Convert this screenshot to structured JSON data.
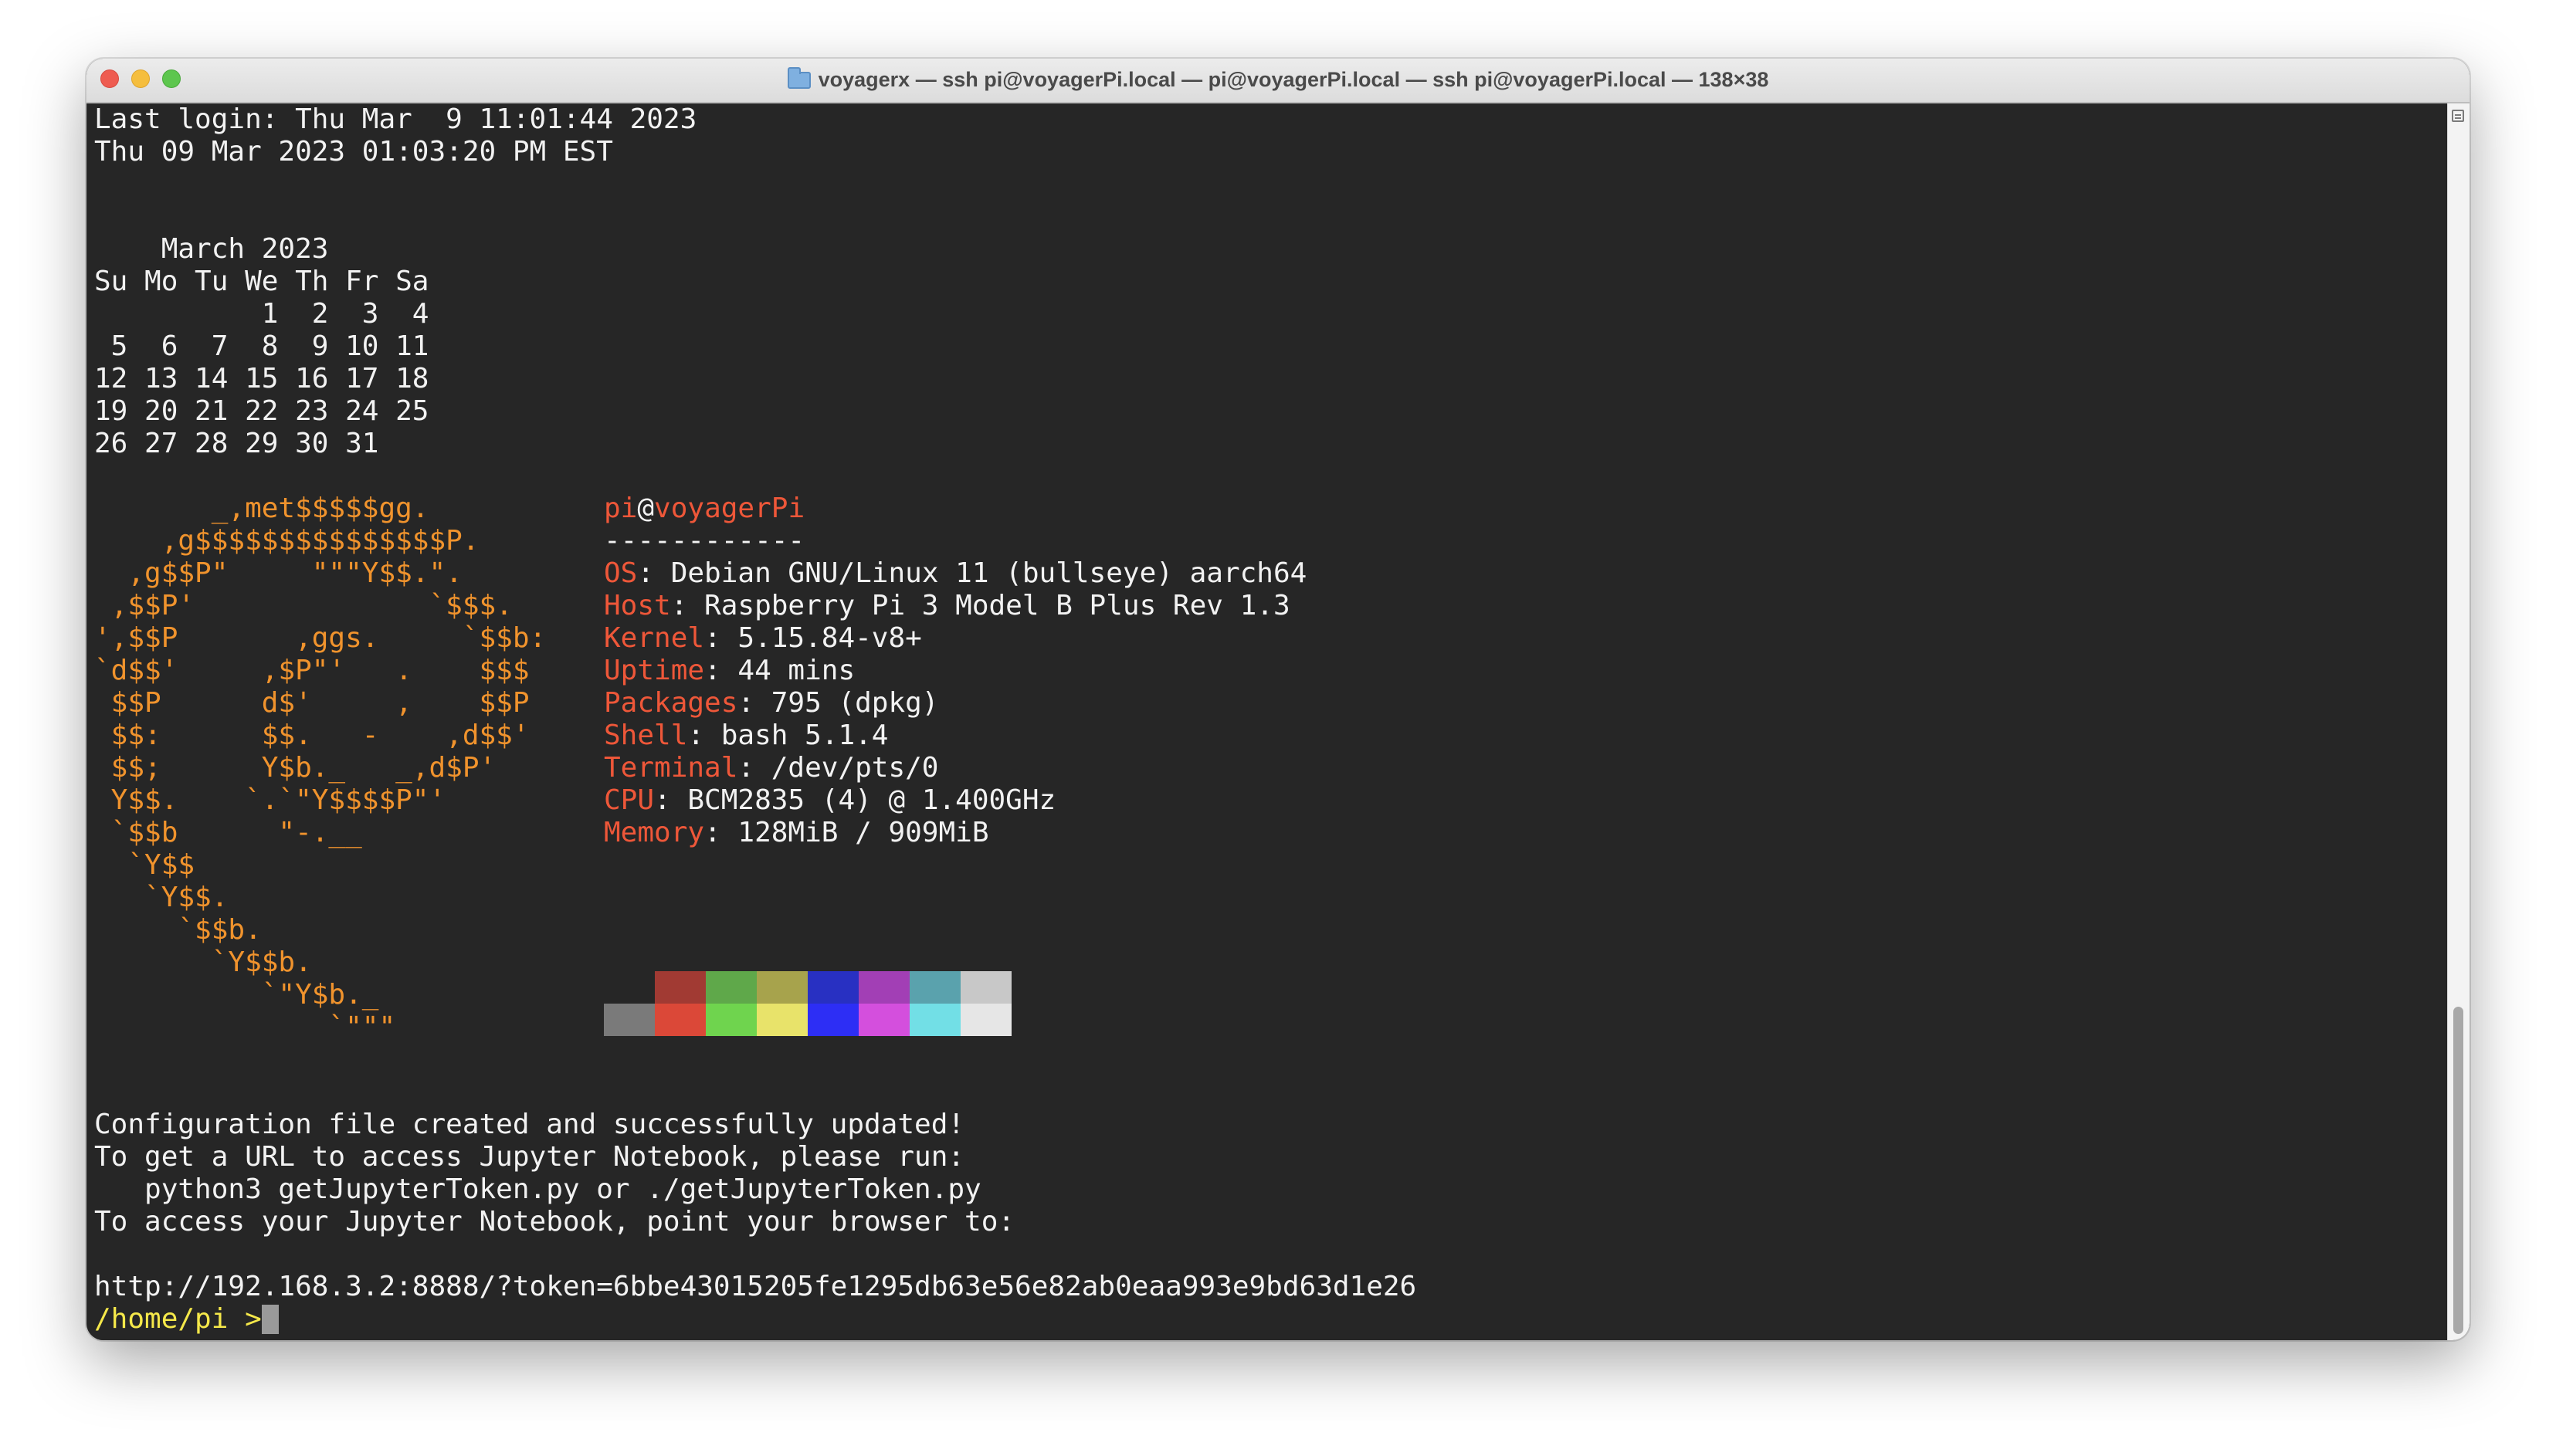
{
  "window": {
    "title": "voyagerx — ssh pi@voyagerPi.local — pi@voyagerPi.local — ssh pi@voyagerPi.local — 138×38"
  },
  "terminal": {
    "last_login": "Last login: Thu Mar  9 11:01:44 2023",
    "date": "Thu 09 Mar 2023 01:03:20 PM EST",
    "calendar": [
      "    March 2023",
      "Su Mo Tu We Th Fr Sa",
      "          1  2  3  4",
      " 5  6  7  8  9 10 11",
      "12 13 14 15 16 17 18",
      "19 20 21 22 23 24 25",
      "26 27 28 29 30 31"
    ],
    "logo": [
      "       _,met$$$$$gg.",
      "    ,g$$$$$$$$$$$$$$$P.",
      "  ,g$$P\"     \"\"\"Y$$.\".",
      " ,$$P'              `$$$.",
      "',$$P       ,ggs.     `$$b:",
      "`d$$'     ,$P\"'   .    $$$",
      " $$P      d$'     ,    $$P",
      " $$:      $$.   -    ,d$$'",
      " $$;      Y$b._   _,d$P'",
      " Y$$.    `.`\"Y$$$$P\"'",
      " `$$b      \"-.__",
      "  `Y$$",
      "   `Y$$.",
      "     `$$b.",
      "       `Y$$b.",
      "          `\"Y$b._",
      "              `\"\"\""
    ],
    "neofetch": {
      "user": "pi",
      "at": "@",
      "host": "voyagerPi",
      "separator": "------------",
      "os_label": "OS",
      "os_value": ": Debian GNU/Linux 11 (bullseye) aarch64",
      "host_label": "Host",
      "host_value": ": Raspberry Pi 3 Model B Plus Rev 1.3",
      "kernel_label": "Kernel",
      "kernel_value": ": 5.15.84-v8+",
      "uptime_label": "Uptime",
      "uptime_value": ": 44 mins",
      "packages_label": "Packages",
      "packages_value": ": 795 (dpkg)",
      "shell_label": "Shell",
      "shell_value": ": bash 5.1.4",
      "terminal_label": "Terminal",
      "terminal_value": ": /dev/pts/0",
      "cpu_label": "CPU",
      "cpu_value": ": BCM2835 (4) @ 1.400GHz",
      "memory_label": "Memory",
      "memory_value": ": 128MiB / 909MiB"
    },
    "palette_top": [
      "#262626",
      "#a13a33",
      "#5fa84a",
      "#a7a34c",
      "#2830c2",
      "#a23fb5",
      "#5aa2ad",
      "#c8c8c8"
    ],
    "palette_bottom": [
      "#7a7a7a",
      "#db4838",
      "#6fd44e",
      "#e8e36a",
      "#2d2ef5",
      "#d44fdd",
      "#72dfe6",
      "#e6e6e6"
    ],
    "messages": [
      "Configuration file created and successfully updated!",
      "To get a URL to access Jupyter Notebook, please run:",
      "   python3 getJupyterToken.py or ./getJupyterToken.py",
      "To access your Jupyter Notebook, point your browser to:"
    ],
    "url": "http://192.168.3.2:8888/?token=6bbe43015205fe1295db63e56e82ab0eaa993e9bd63d1e26",
    "prompt": "/home/pi >"
  }
}
